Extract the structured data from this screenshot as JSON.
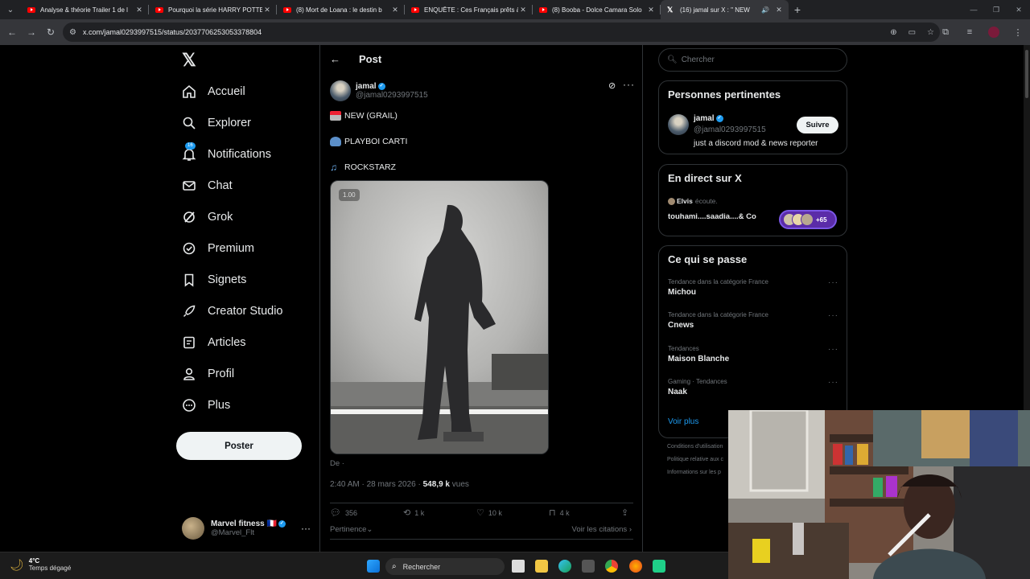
{
  "browser": {
    "tabs": [
      {
        "title": "Analyse & théorie Trailer 1 de l",
        "icon": "youtube-icon",
        "active": false
      },
      {
        "title": "Pourquoi la série HARRY POTTE",
        "icon": "youtube-icon",
        "active": false
      },
      {
        "title": "(8) Mort de Loana : le destin b",
        "icon": "youtube-icon",
        "active": false
      },
      {
        "title": "ENQUÊTE : Ces Français prêts à",
        "icon": "youtube-icon",
        "active": false
      },
      {
        "title": "(8) Booba - Dolce Camara Solo",
        "icon": "youtube-icon",
        "active": false
      },
      {
        "title": "(16) jamal sur X : \" NEW",
        "icon": "x-icon",
        "active": true
      }
    ],
    "url": "x.com/jamal0293997515/status/2037706253053378804"
  },
  "nav": {
    "items": [
      {
        "label": "Accueil",
        "icon": "home-icon"
      },
      {
        "label": "Explorer",
        "icon": "search-icon"
      },
      {
        "label": "Notifications",
        "icon": "bell-icon",
        "badge": "16"
      },
      {
        "label": "Chat",
        "icon": "mail-icon"
      },
      {
        "label": "Grok",
        "icon": "grok-icon"
      },
      {
        "label": "Premium",
        "icon": "premium-icon"
      },
      {
        "label": "Signets",
        "icon": "bookmark-icon"
      },
      {
        "label": "Creator Studio",
        "icon": "rocket-icon"
      },
      {
        "label": "Articles",
        "icon": "article-icon"
      },
      {
        "label": "Profil",
        "icon": "person-icon"
      },
      {
        "label": "Plus",
        "icon": "more-circle-icon"
      }
    ],
    "post_button": "Poster",
    "account": {
      "name": "Marvel fitness 🇫🇷",
      "handle": "@Marvel_Flt"
    }
  },
  "post": {
    "header": "Post",
    "author_name": "jamal",
    "author_handle": "@jamal0293997515",
    "lines": [
      "NEW (GRAIL)",
      "PLAYBOI CARTI",
      "ROCKSTARZ"
    ],
    "playback_rate": "1.00",
    "from_label": "De",
    "timestamp": "2:40 AM · 28 mars 2026 · ",
    "views_count": "548,9 k",
    "views_label": " vues",
    "stats": {
      "replies": "356",
      "reposts": "1 k",
      "likes": "10 k",
      "bookmarks": "4 k"
    },
    "sort_label": "Pertinence",
    "quotes_label": "Voir les citations"
  },
  "sidebar": {
    "search_placeholder": "Chercher",
    "relevant": {
      "title": "Personnes pertinentes",
      "name": "jamal",
      "handle": "@jamal0293997515",
      "bio": "just a discord mod & news reporter",
      "follow_label": "Suivre"
    },
    "live": {
      "title": "En direct sur X",
      "listener": "Elvis",
      "listening": "écoute.",
      "space_title": "touhami....saadia....& Co",
      "count": "+65"
    },
    "trends": {
      "title": "Ce qui se passe",
      "items": [
        {
          "context": "Tendance dans la catégorie France",
          "name": "Michou"
        },
        {
          "context": "Tendance dans la catégorie France",
          "name": "Cnews"
        },
        {
          "context": "Tendances",
          "name": "Maison Blanche"
        },
        {
          "context": "Gaming · Tendances",
          "name": "Naak"
        }
      ],
      "more_label": "Voir plus"
    },
    "footer": [
      "Conditions d'utilisation",
      "Politique relative aux c",
      "Informations sur les p"
    ]
  },
  "taskbar": {
    "temperature": "4°C",
    "weather": "Temps dégagé",
    "search_label": "Rechercher"
  }
}
